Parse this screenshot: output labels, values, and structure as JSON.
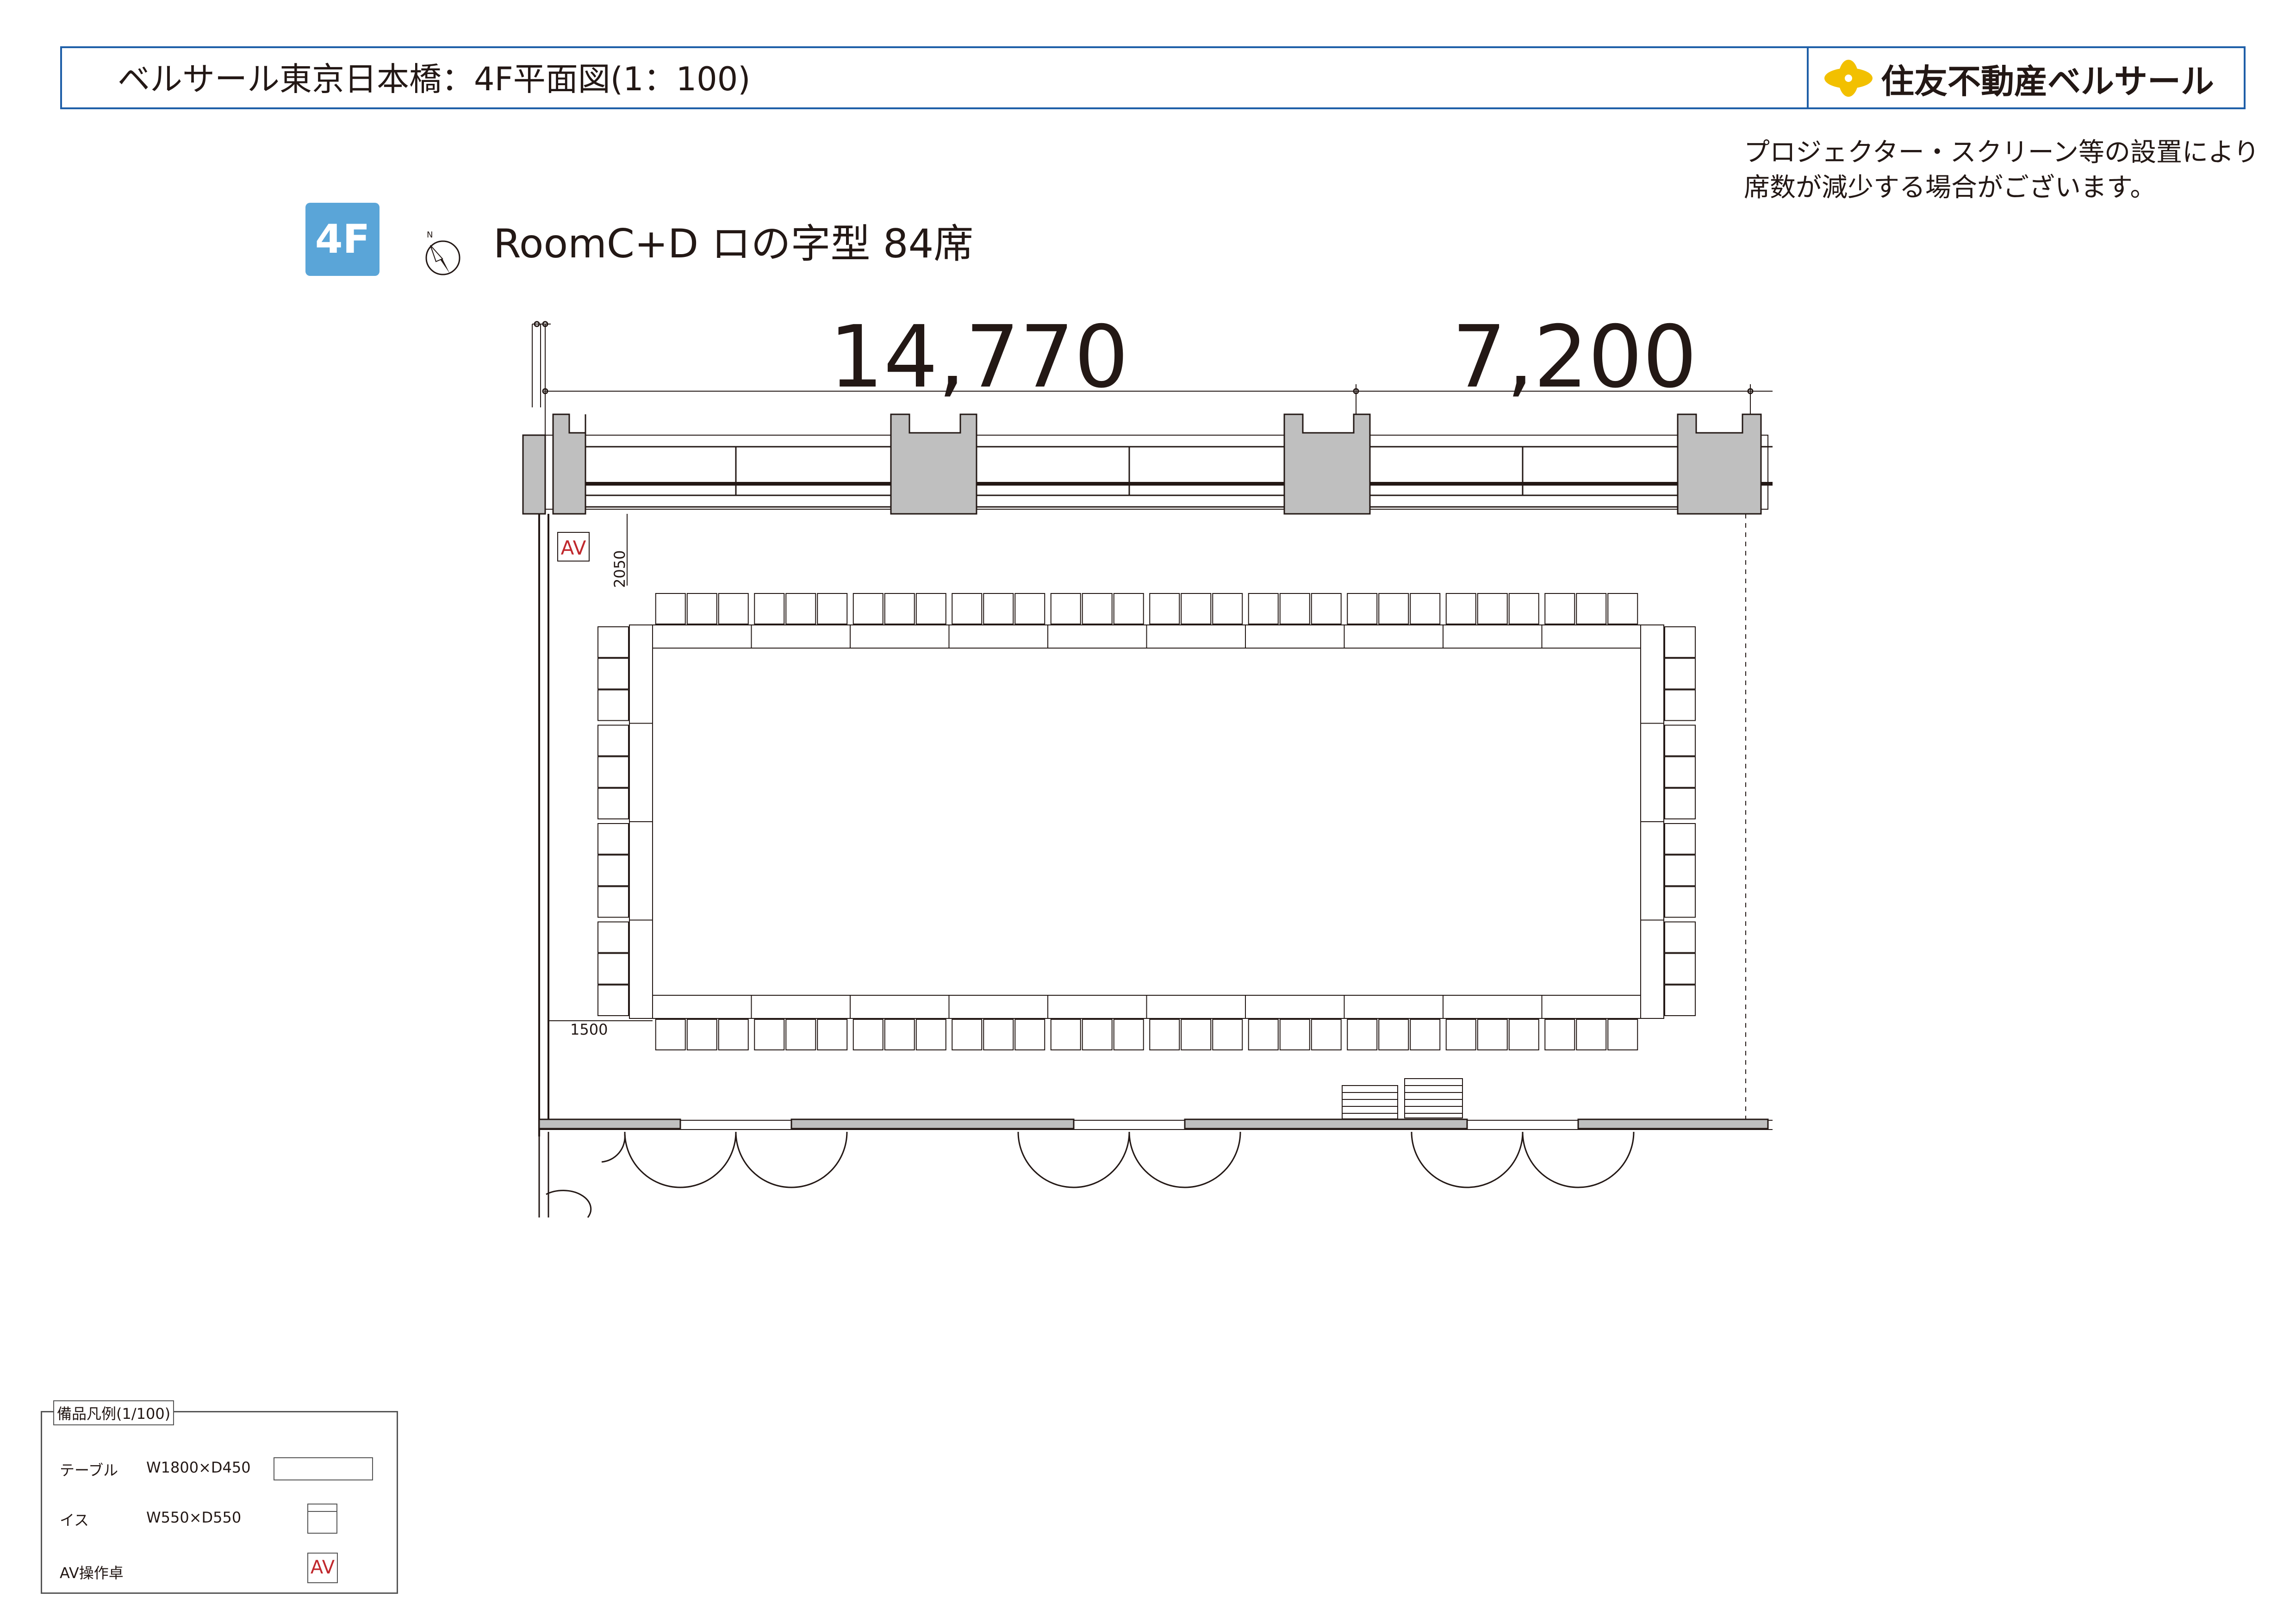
{
  "header": {
    "title": "ベルサール東京日本橋：4F平面図(1：100)",
    "brand": "住友不動産ベルサール",
    "border_color": "#1f5fa8"
  },
  "note": {
    "line1": "プロジェクター・スクリーン等の設置により",
    "line2": "席数が減少する場合がございます。"
  },
  "floor_badge": {
    "label": "4F",
    "color": "#5aa5d8"
  },
  "north_label": "N",
  "room_title": "RoomC+D ロの字型 84席",
  "plan": {
    "dim_left": "14,770",
    "dim_right": "7,200",
    "dim_2050": "2050",
    "dim_1500": "1500",
    "av_label": "AV",
    "seats": 84
  },
  "legend": {
    "title": "備品凡例(1/100)",
    "items": [
      {
        "name": "テーブル",
        "size": "W1800×D450",
        "icon": "table-rect"
      },
      {
        "name": "イス",
        "size": "W550×D550",
        "icon": "chair-square"
      },
      {
        "name": "AV操作卓",
        "size": "",
        "icon": "av-box"
      }
    ]
  }
}
